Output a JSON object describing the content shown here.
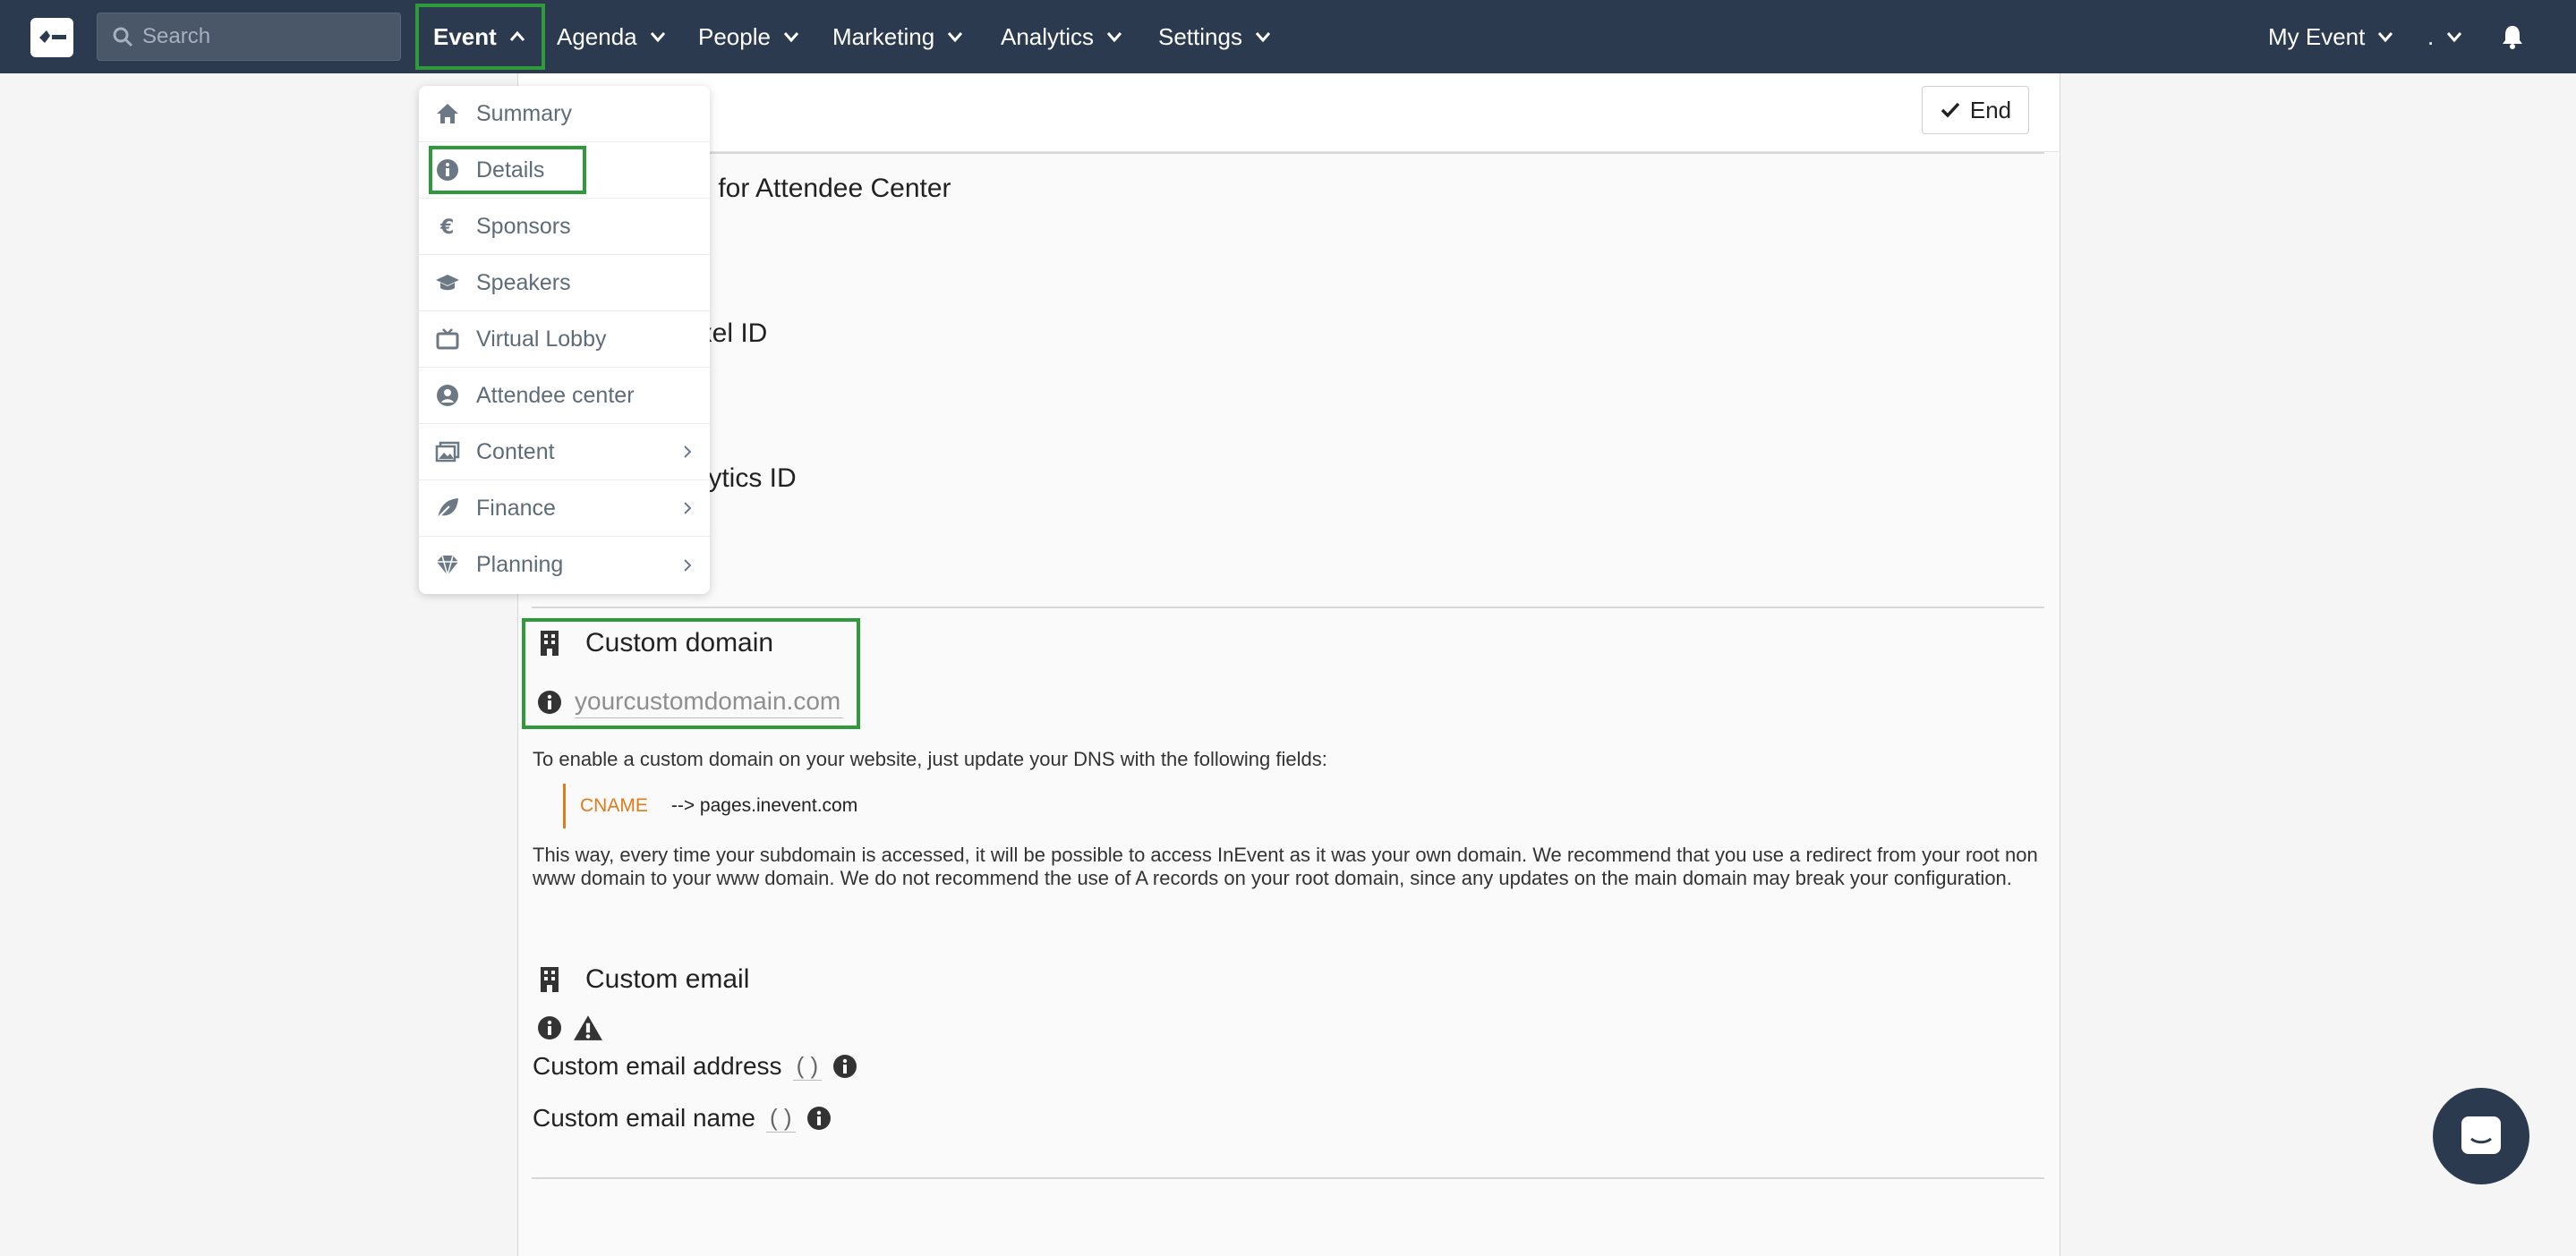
{
  "topbar": {
    "search_placeholder": "Search",
    "nav": [
      {
        "label": "Event"
      },
      {
        "label": "Agenda"
      },
      {
        "label": "People"
      },
      {
        "label": "Marketing"
      },
      {
        "label": "Analytics"
      },
      {
        "label": "Settings"
      }
    ],
    "my_event": "My Event",
    "dot_menu": "."
  },
  "header": {
    "end_label": "End"
  },
  "partial_sections": [
    "S for Attendee Center",
    "ixel ID",
    "alytics ID"
  ],
  "event_menu": {
    "items": [
      {
        "label": "Summary",
        "icon": "home-icon"
      },
      {
        "label": "Details",
        "icon": "info-icon"
      },
      {
        "label": "Sponsors",
        "icon": "euro-icon"
      },
      {
        "label": "Speakers",
        "icon": "graduation-cap-icon"
      },
      {
        "label": "Virtual Lobby",
        "icon": "tv-icon"
      },
      {
        "label": "Attendee center",
        "icon": "user-circle-icon"
      },
      {
        "label": "Content",
        "icon": "images-icon"
      },
      {
        "label": "Finance",
        "icon": "leaf-icon"
      },
      {
        "label": "Planning",
        "icon": "diamond-icon"
      }
    ]
  },
  "custom_domain": {
    "title": "Custom domain",
    "placeholder": "yourcustomdomain.com",
    "intro": "To enable a custom domain on your website, just update your DNS with the following fields:",
    "record_type": "CNAME",
    "record_value": "--> pages.inevent.com",
    "note": "This way, every time your subdomain is accessed, it will be possible to access InEvent as it was your own domain. We recommend that you use a redirect from your root non www domain to your www domain. We do not recommend the use of A records on your root domain, since any updates on the main domain may break your configuration."
  },
  "custom_email": {
    "title": "Custom email",
    "address_label": "Custom email address",
    "address_value": "( )",
    "name_label": "Custom email name",
    "name_value": "( )"
  },
  "colors": {
    "topbar": "#2b3a4f",
    "highlight": "#2e9a3a",
    "cname_accent": "#e07b1c"
  }
}
